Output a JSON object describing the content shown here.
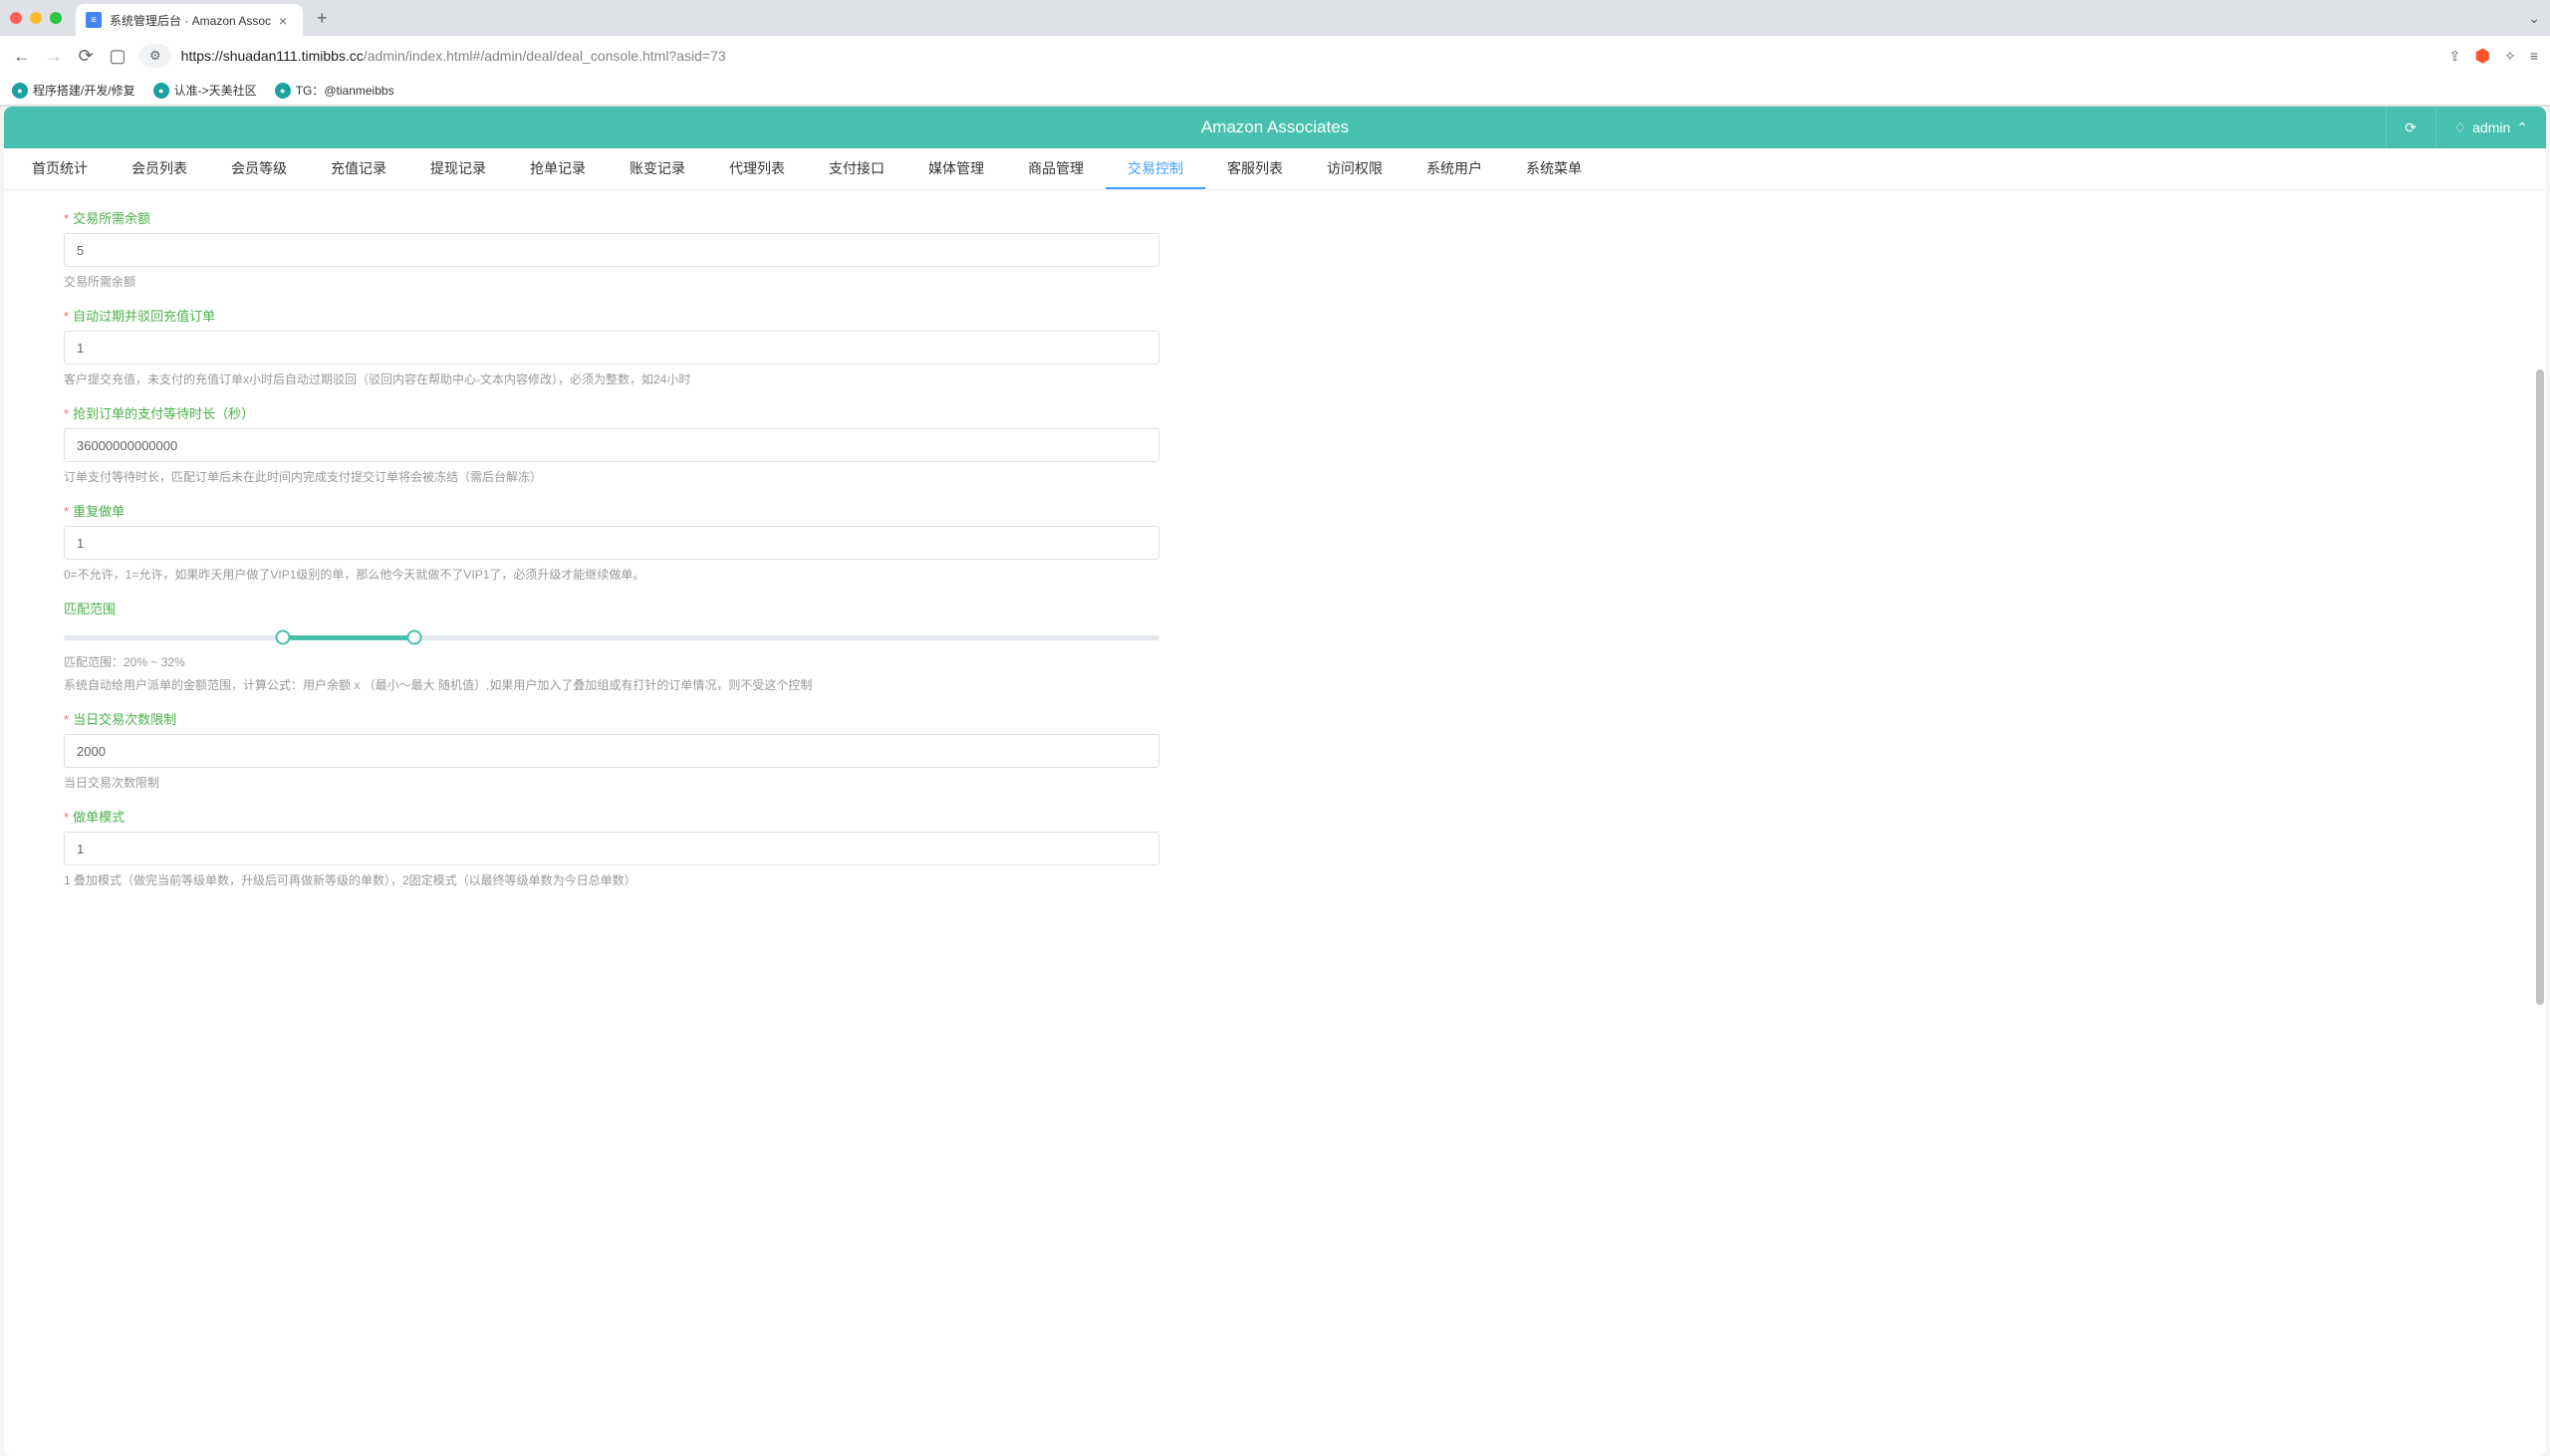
{
  "browser": {
    "tab_title": "系统管理后台 · Amazon Assoc",
    "url_domain": "shuadan111.timibbs.cc",
    "url_path": "/admin/index.html#/admin/deal/deal_console.html?asid=73",
    "url_prefix": "https://",
    "bookmarks": [
      "程序搭建/开发/修复",
      "认准->天美社区",
      "TG：@tianmeibbs"
    ]
  },
  "app": {
    "title": "Amazon Associates",
    "username": "admin",
    "nav": [
      "首页统计",
      "会员列表",
      "会员等级",
      "充值记录",
      "提现记录",
      "抢单记录",
      "账变记录",
      "代理列表",
      "支付接口",
      "媒体管理",
      "商品管理",
      "交易控制",
      "客服列表",
      "访问权限",
      "系统用户",
      "系统菜单"
    ],
    "active_nav_index": 11
  },
  "form": {
    "fields": [
      {
        "label": "交易所需余额",
        "required": true,
        "value": "5",
        "hint": "交易所需余额"
      },
      {
        "label": "自动过期并驳回充值订单",
        "required": true,
        "value": "1",
        "hint": "客户提交充值，未支付的充值订单x小时后自动过期驳回（驳回内容在帮助中心-文本内容修改），必须为整数，如24小时"
      },
      {
        "label": "抢到订单的支付等待时长（秒）",
        "required": true,
        "value": "36000000000000",
        "hint": "订单支付等待时长，匹配订单后未在此时间内完成支付提交订单将会被冻结（需后台解冻）"
      },
      {
        "label": "重复做单",
        "required": true,
        "value": "1",
        "hint": "0=不允许，1=允许，如果昨天用户做了VIP1级别的单，那么他今天就做不了VIP1了，必须升级才能继续做单。"
      },
      {
        "label": "匹配范围",
        "required": false,
        "type": "slider",
        "range": [
          20,
          32
        ],
        "hint1": "匹配范围：20% ~ 32%",
        "hint2": "系统自动给用户派单的金额范围，计算公式：用户余额 x （最小～最大 随机值）,如果用户加入了叠加组或有打针的订单情况，则不受这个控制"
      },
      {
        "label": "当日交易次数限制",
        "required": true,
        "value": "2000",
        "hint": "当日交易次数限制"
      },
      {
        "label": "做单模式",
        "required": true,
        "value": "1",
        "hint": "1 叠加模式（做完当前等级单数，升级后可再做新等级的单数），2固定模式（以最终等级单数为今日总单数）"
      }
    ]
  }
}
